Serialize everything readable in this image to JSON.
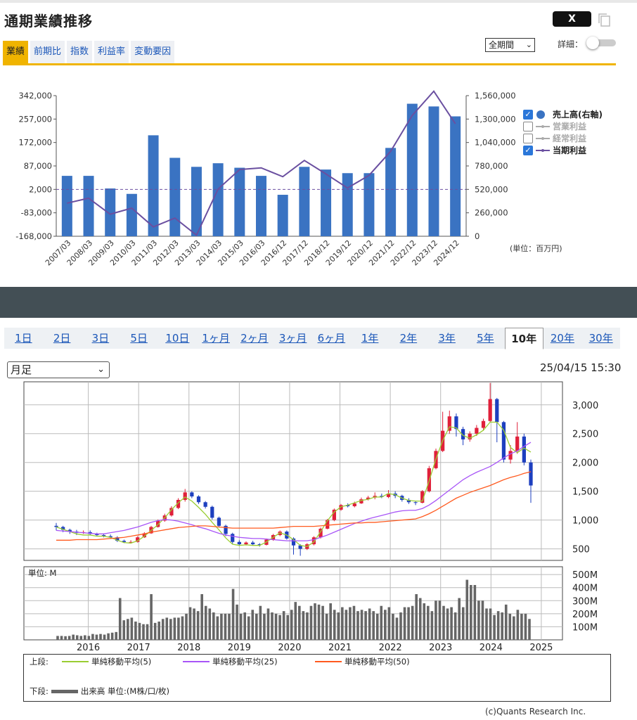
{
  "header": {
    "title": "通期業績推移",
    "share_label": "X",
    "tabs": [
      {
        "label": "業績",
        "active": true
      },
      {
        "label": "前期比",
        "active": false
      },
      {
        "label": "指数",
        "active": false
      },
      {
        "label": "利益率",
        "active": false
      },
      {
        "label": "変動要因",
        "active": false
      }
    ],
    "period_select": "全期間",
    "detail_label": "詳細：",
    "detail_toggle": "off"
  },
  "performance_legend": [
    {
      "label": "売上高(右軸)",
      "checked": true,
      "enabled": true,
      "color": "#3a73c2"
    },
    {
      "label": "営業利益",
      "checked": false,
      "enabled": false,
      "color": "#aaaaaa"
    },
    {
      "label": "経常利益",
      "checked": false,
      "enabled": false,
      "color": "#aaaaaa"
    },
    {
      "label": "当期利益",
      "checked": true,
      "enabled": true,
      "color": "#6a4fa0"
    }
  ],
  "performance_unit": "(単位：百万円)",
  "colors": {
    "accent": "#f0b400",
    "bar": "#3a73c2",
    "profit_line": "#6a4fa0",
    "band": "#434f55",
    "candle_up": "#e0203a",
    "candle_down": "#1d3fbf",
    "ma5": "#9acd32",
    "ma25": "#a855f7",
    "ma50": "#ff5a1f",
    "volume": "#666666"
  },
  "chart_data": [
    {
      "type": "bar",
      "title": "通期業績推移",
      "categories": [
        "2007/03",
        "2008/03",
        "2009/03",
        "2010/03",
        "2011/03",
        "2012/03",
        "2013/03",
        "2014/03",
        "2015/03",
        "2016/03",
        "2016/12",
        "2017/12",
        "2018/12",
        "2019/12",
        "2020/12",
        "2021/12",
        "2022/12",
        "2023/12",
        "2024/12"
      ],
      "left_axis": {
        "ticks": [
          "342,000",
          "257,000",
          "172,000",
          "87,000",
          "2,000",
          "-83,000",
          "-168,000"
        ],
        "ylim": [
          -168000,
          342000
        ]
      },
      "right_axis": {
        "ticks": [
          "1,560,000",
          "1,300,000",
          "1,040,000",
          "780,000",
          "520,000",
          "260,000",
          "0"
        ],
        "ylim": [
          0,
          1560000
        ]
      },
      "series": [
        {
          "name": "売上高(右軸)",
          "type": "bar",
          "axis": "right",
          "values": [
            670000,
            670000,
            530000,
            470000,
            1120000,
            870000,
            770000,
            810000,
            760000,
            670000,
            460000,
            770000,
            740000,
            700000,
            700000,
            980000,
            1470000,
            1440000,
            1330000
          ]
        },
        {
          "name": "当期利益",
          "type": "line",
          "axis": "left",
          "values": [
            -48000,
            -30000,
            -88000,
            -66000,
            -134000,
            -102000,
            -164000,
            3000,
            74000,
            80000,
            48000,
            107000,
            58000,
            7000,
            53000,
            140000,
            270000,
            358000,
            240000
          ]
        }
      ],
      "reference_line": 2000
    },
    {
      "type": "candlestick",
      "x_ticks": [
        "2016",
        "2017",
        "2018",
        "2019",
        "2020",
        "2021",
        "2022",
        "2023",
        "2024",
        "2025"
      ],
      "y_ticks": [
        "3,000",
        "2,500",
        "2,000",
        "1,500",
        "1,000",
        "500"
      ],
      "ylim": [
        300,
        3400
      ],
      "ma_series": [
        {
          "name": "単純移動平均(5)",
          "values": [
            880,
            840,
            800,
            760,
            740,
            740,
            720,
            720,
            700,
            650,
            610,
            600,
            640,
            720,
            820,
            920,
            1040,
            1180,
            1300,
            1400,
            1330,
            1220,
            1100,
            960,
            830,
            690,
            580,
            560,
            570,
            560,
            560,
            620,
            700,
            780,
            740,
            660,
            560,
            540,
            620,
            800,
            990,
            1140,
            1230,
            1260,
            1300,
            1340,
            1360,
            1400,
            1400,
            1460,
            1440,
            1380,
            1340,
            1330,
            1330,
            1680,
            2060,
            2380,
            2620,
            2600,
            2470,
            2420,
            2480,
            2560,
            2700,
            2700,
            2560,
            2260,
            2170,
            2250,
            2180
          ]
        },
        {
          "name": "単純移動平均(25)",
          "values": [
            820,
            810,
            800,
            790,
            780,
            770,
            760,
            760,
            780,
            800,
            820,
            850,
            880,
            920,
            960,
            990,
            1010,
            1000,
            980,
            950,
            920,
            880,
            850,
            810,
            770,
            740,
            720,
            700,
            690,
            680,
            680,
            670,
            660,
            650,
            640,
            640,
            640,
            640,
            660,
            700,
            740,
            790,
            840,
            890,
            940,
            980,
            1020,
            1050,
            1080,
            1110,
            1140,
            1160,
            1170,
            1170,
            1200,
            1260,
            1340,
            1430,
            1520,
            1610,
            1700,
            1770,
            1830,
            1880,
            1930,
            2000,
            2080,
            2150,
            2200,
            2280,
            2350
          ]
        },
        {
          "name": "単純移動平均(50)",
          "values": [
            650,
            650,
            650,
            660,
            660,
            660,
            660,
            670,
            680,
            690,
            700,
            720,
            740,
            760,
            790,
            810,
            830,
            850,
            870,
            880,
            890,
            900,
            900,
            890,
            880,
            870,
            860,
            860,
            860,
            860,
            860,
            860,
            860,
            870,
            880,
            890,
            890,
            890,
            890,
            900,
            910,
            920,
            930,
            940,
            950,
            950,
            960,
            960,
            970,
            980,
            990,
            1000,
            1010,
            1020,
            1060,
            1110,
            1170,
            1240,
            1310,
            1380,
            1430,
            1480,
            1520,
            1560,
            1600,
            1650,
            1700,
            1740,
            1770,
            1810,
            1840
          ]
        }
      ],
      "candles": [
        [
          900,
          880,
          950,
          820
        ],
        [
          880,
          830,
          900,
          790
        ],
        [
          830,
          800,
          850,
          760
        ],
        [
          800,
          780,
          830,
          740
        ],
        [
          780,
          790,
          820,
          760
        ],
        [
          790,
          760,
          820,
          740
        ],
        [
          760,
          740,
          780,
          720
        ],
        [
          740,
          720,
          770,
          700
        ],
        [
          720,
          700,
          750,
          680
        ],
        [
          700,
          640,
          720,
          620
        ],
        [
          640,
          620,
          660,
          600
        ],
        [
          620,
          620,
          650,
          600
        ],
        [
          620,
          700,
          720,
          610
        ],
        [
          700,
          770,
          790,
          690
        ],
        [
          770,
          880,
          900,
          760
        ],
        [
          880,
          990,
          1010,
          870
        ],
        [
          990,
          1080,
          1110,
          970
        ],
        [
          1080,
          1210,
          1240,
          1060
        ],
        [
          1210,
          1350,
          1380,
          1190
        ],
        [
          1350,
          1480,
          1540,
          1320
        ],
        [
          1480,
          1410,
          1500,
          1380
        ],
        [
          1410,
          1310,
          1430,
          1280
        ],
        [
          1310,
          1230,
          1330,
          1200
        ],
        [
          1230,
          1040,
          1250,
          1010
        ],
        [
          1040,
          900,
          1060,
          870
        ],
        [
          900,
          760,
          920,
          720
        ],
        [
          760,
          620,
          780,
          590
        ],
        [
          620,
          580,
          650,
          560
        ],
        [
          580,
          610,
          630,
          560
        ],
        [
          610,
          580,
          640,
          560
        ],
        [
          580,
          570,
          600,
          540
        ],
        [
          570,
          660,
          680,
          560
        ],
        [
          660,
          740,
          760,
          640
        ],
        [
          740,
          800,
          820,
          720
        ],
        [
          800,
          680,
          820,
          660
        ],
        [
          680,
          560,
          700,
          400
        ],
        [
          560,
          500,
          580,
          380
        ],
        [
          500,
          580,
          600,
          480
        ],
        [
          580,
          700,
          720,
          560
        ],
        [
          700,
          850,
          870,
          680
        ],
        [
          850,
          1000,
          1020,
          840
        ],
        [
          1000,
          1180,
          1200,
          980
        ],
        [
          1180,
          1260,
          1280,
          1160
        ],
        [
          1260,
          1240,
          1290,
          1220
        ],
        [
          1240,
          1290,
          1320,
          1220
        ],
        [
          1290,
          1360,
          1390,
          1280
        ],
        [
          1360,
          1390,
          1420,
          1340
        ],
        [
          1390,
          1420,
          1480,
          1360
        ],
        [
          1420,
          1400,
          1460,
          1380
        ],
        [
          1400,
          1460,
          1520,
          1380
        ],
        [
          1460,
          1420,
          1500,
          1380
        ],
        [
          1420,
          1350,
          1440,
          1320
        ],
        [
          1350,
          1310,
          1380,
          1280
        ],
        [
          1310,
          1300,
          1330,
          1260
        ],
        [
          1300,
          1500,
          1520,
          1290
        ],
        [
          1500,
          1900,
          1940,
          1480
        ],
        [
          1900,
          2200,
          2240,
          1880
        ],
        [
          2200,
          2550,
          2880,
          2180
        ],
        [
          2550,
          2800,
          2900,
          2500
        ],
        [
          2800,
          2580,
          2850,
          2450
        ],
        [
          2580,
          2400,
          2620,
          2300
        ],
        [
          2400,
          2500,
          2540,
          2360
        ],
        [
          2500,
          2600,
          2650,
          2460
        ],
        [
          2600,
          2720,
          2760,
          2550
        ],
        [
          2720,
          3100,
          3380,
          2700
        ],
        [
          3100,
          2700,
          3120,
          2350
        ],
        [
          2700,
          2050,
          2720,
          2000
        ],
        [
          2050,
          2200,
          2300,
          1980
        ],
        [
          2200,
          2450,
          2700,
          2150
        ],
        [
          2450,
          2000,
          2500,
          1950
        ],
        [
          2000,
          1600,
          2050,
          1300
        ]
      ]
    },
    {
      "type": "bar",
      "title": "出来高",
      "y_ticks": [
        "500M",
        "400M",
        "300M",
        "200M",
        "100M"
      ],
      "ylim": [
        0,
        560
      ],
      "x_ticks": [
        "2016",
        "2017",
        "2018",
        "2019",
        "2020",
        "2021",
        "2022",
        "2023",
        "2024",
        "2025"
      ],
      "values": [
        30,
        30,
        28,
        30,
        40,
        35,
        30,
        35,
        30,
        45,
        40,
        45,
        40,
        50,
        55,
        60,
        320,
        150,
        160,
        170,
        140,
        130,
        120,
        120,
        350,
        130,
        140,
        160,
        170,
        160,
        170,
        170,
        180,
        200,
        250,
        240,
        220,
        350,
        260,
        240,
        210,
        180,
        200,
        200,
        200,
        390,
        270,
        200,
        210,
        180,
        230,
        200,
        260,
        200,
        240,
        210,
        200,
        190,
        220,
        190,
        230,
        290,
        260,
        220,
        210,
        260,
        280,
        270,
        260,
        200,
        280,
        230,
        210,
        250,
        230,
        250,
        260,
        220,
        230,
        220,
        240,
        220,
        200,
        260,
        230,
        250,
        200,
        170,
        210,
        250,
        250,
        260,
        350,
        320,
        280,
        260,
        220,
        300,
        300,
        260,
        240,
        250,
        210,
        320,
        250,
        460,
        420,
        420,
        300,
        300,
        240,
        240,
        190,
        220,
        210,
        270,
        200,
        180,
        230,
        200,
        200,
        160
      ]
    }
  ],
  "period_tabs": [
    {
      "label": "1日",
      "active": false
    },
    {
      "label": "2日",
      "active": false
    },
    {
      "label": "3日",
      "active": false
    },
    {
      "label": "5日",
      "active": false
    },
    {
      "label": "10日",
      "active": false
    },
    {
      "label": "1ヶ月",
      "active": false
    },
    {
      "label": "2ヶ月",
      "active": false
    },
    {
      "label": "3ヶ月",
      "active": false
    },
    {
      "label": "6ヶ月",
      "active": false
    },
    {
      "label": "1年",
      "active": false
    },
    {
      "label": "2年",
      "active": false
    },
    {
      "label": "3年",
      "active": false
    },
    {
      "label": "5年",
      "active": false
    },
    {
      "label": "10年",
      "active": true
    },
    {
      "label": "20年",
      "active": false
    },
    {
      "label": "30年",
      "active": false
    }
  ],
  "asi_select": "月足",
  "timestamp": "25/04/15 15:30",
  "volume_unit_label": "単位: M",
  "chart_legend": {
    "upper_label": "上段:",
    "ma5": "単純移動平均(5)",
    "ma25": "単純移動平均(25)",
    "ma50": "単純移動平均(50)",
    "lower_label": "下段:",
    "volume": "出来高 単位:(M株/口/枚)"
  },
  "copyright": "(c)Quants Research Inc."
}
